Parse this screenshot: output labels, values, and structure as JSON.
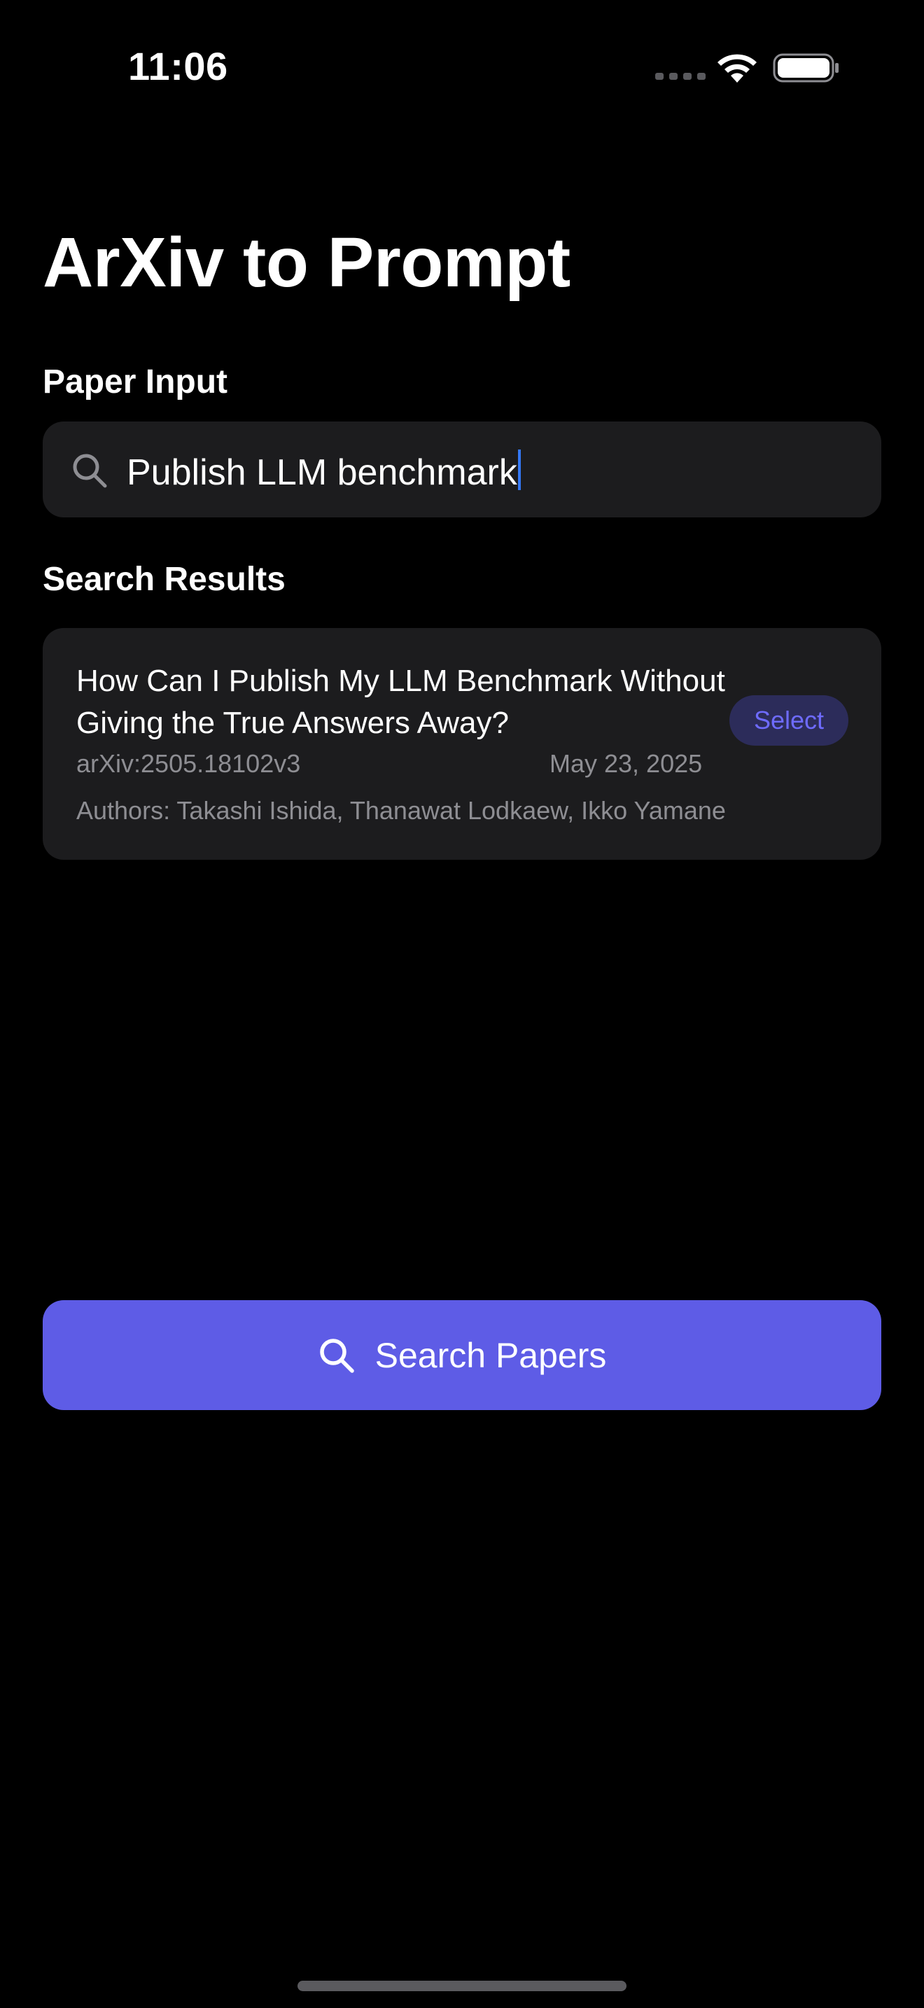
{
  "status_bar": {
    "time": "11:06",
    "icons": [
      "signal-icon",
      "wifi-icon",
      "battery-icon"
    ]
  },
  "app": {
    "title": "ArXiv to Prompt"
  },
  "paper_input": {
    "label": "Paper Input",
    "value": "Publish LLM benchmark",
    "icon": "search-icon"
  },
  "search_results": {
    "label": "Search Results",
    "items": [
      {
        "title": "How Can I Publish My LLM Benchmark Without Giving the True Answers Away?",
        "arxiv_id": "arXiv:2505.18102v3",
        "date": "May 23, 2025",
        "authors": "Authors: Takashi Ishida, Thanawat Lodkaew, Ikko Yamane",
        "action_label": "Select"
      }
    ]
  },
  "primary_action": {
    "label": "Search Papers",
    "icon": "search-icon"
  },
  "colors": {
    "background": "#000000",
    "surface": "#1c1c1e",
    "accent": "#5e5ce6",
    "secondary_text": "#8e8e93",
    "caret": "#3478f6"
  }
}
